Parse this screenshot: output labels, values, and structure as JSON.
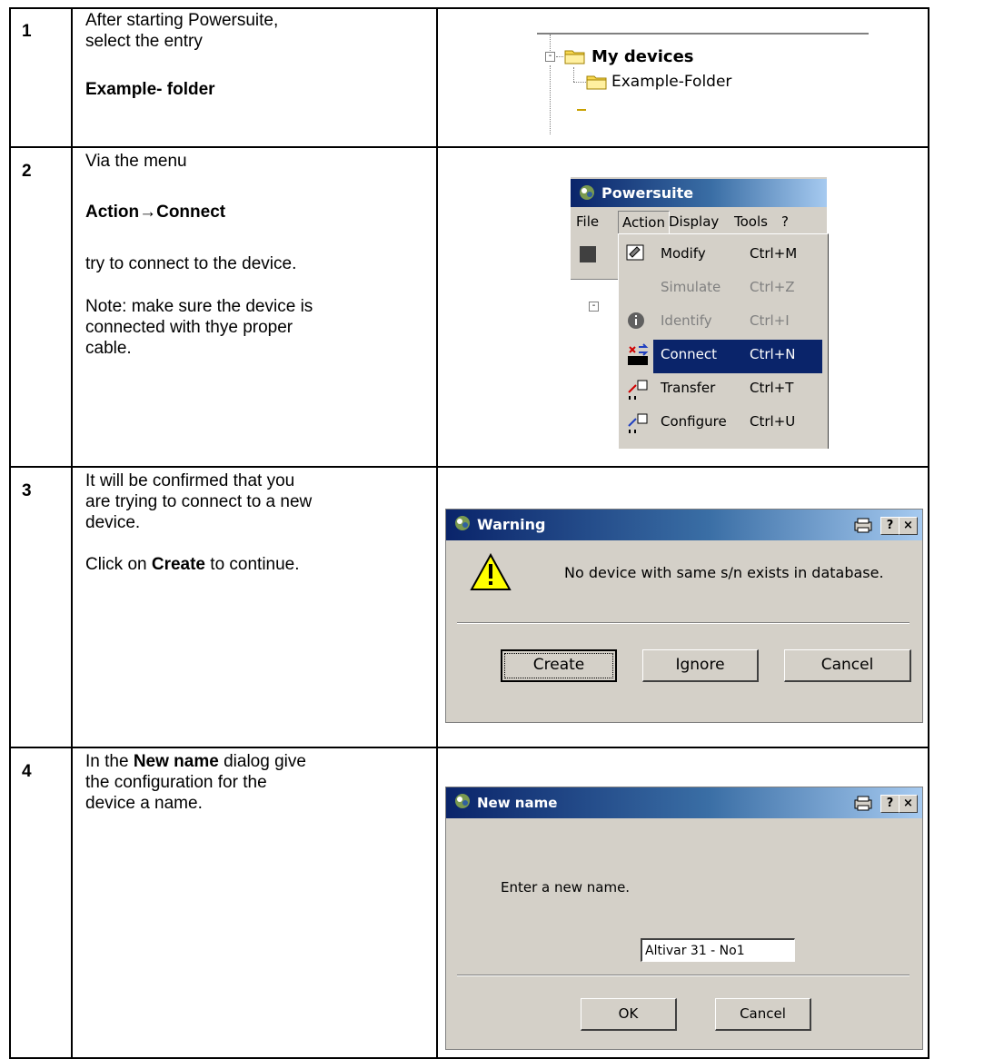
{
  "steps": [
    {
      "number": "1",
      "line1": "After starting Powersuite,",
      "line2": "select the entry",
      "bold": "Example- folder"
    },
    {
      "number": "2",
      "line1": "Via the menu",
      "bold": "Action→Connect",
      "line2": "try to connect to the device.",
      "note1": "Note: make sure the device is",
      "note2": "connected with thye proper",
      "note3": "cable."
    },
    {
      "number": "3",
      "line1": "It will be confirmed that you",
      "line2": "are trying to connect to a new",
      "line3": "device.",
      "click_pre": "Click on ",
      "click_bold": "Create",
      "click_post": " to continue."
    },
    {
      "number": "4",
      "pre": "In the ",
      "bold": "New name",
      "post": " dialog give",
      "line2": "the configuration for the",
      "line3": "device a name."
    }
  ],
  "tree": {
    "root_minus": "-",
    "root_label": "My devices",
    "child_label": "Example-Folder"
  },
  "menu_window": {
    "title": "Powersuite",
    "menubar": [
      "File",
      "Action",
      "Display",
      "Tools",
      "?"
    ],
    "items": [
      {
        "label": "Modify",
        "shortcut": "Ctrl+M",
        "icon": "modify-icon"
      },
      {
        "label": "Simulate",
        "shortcut": "Ctrl+Z",
        "icon": "none"
      },
      {
        "label": "Identify",
        "shortcut": "Ctrl+I",
        "icon": "info-icon"
      },
      {
        "label": "Connect",
        "shortcut": "Ctrl+N",
        "icon": "connect-icon"
      },
      {
        "label": "Transfer",
        "shortcut": "Ctrl+T",
        "icon": "transfer-icon"
      },
      {
        "label": "Configure",
        "shortcut": "Ctrl+U",
        "icon": "configure-icon"
      }
    ],
    "selected_item": "Connect"
  },
  "warning_dialog": {
    "title": "Warning",
    "help_button": "?",
    "close_button": "×",
    "message": "No device with same s/n exists in database.",
    "buttons": {
      "create": "Create",
      "ignore": "Ignore",
      "cancel": "Cancel"
    }
  },
  "newname_dialog": {
    "title": "New name",
    "help_button": "?",
    "close_button": "×",
    "prompt": "Enter a new name.",
    "input_value": "Altivar 31 - No1",
    "buttons": {
      "ok": "OK",
      "cancel": "Cancel"
    }
  },
  "colors": {
    "titlebar_start": "#0a246a",
    "titlebar_end": "#a6caf0",
    "dialog_bg": "#d4d0c8",
    "selected_bg": "#0a246a"
  }
}
